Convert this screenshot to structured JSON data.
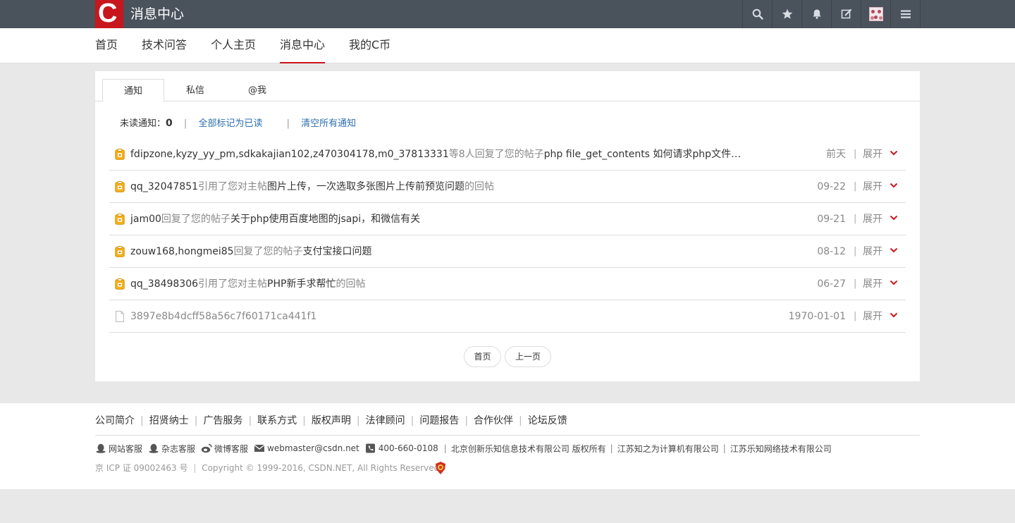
{
  "header": {
    "logo_letter": "C",
    "app_title": "消息中心",
    "icons": [
      "search-icon",
      "star-icon",
      "bell-icon",
      "edit-icon",
      "avatar",
      "menu-icon"
    ]
  },
  "nav": {
    "items": [
      "首页",
      "技术问答",
      "个人主页",
      "消息中心",
      "我的C币"
    ],
    "active": "消息中心"
  },
  "tabs": {
    "items": [
      "通知",
      "私信",
      "@我"
    ],
    "active": "通知"
  },
  "summary": {
    "unread_label": "未读通知：",
    "unread_count": "0",
    "mark_all_read": "全部标记为已读",
    "clear_all": "清空所有通知"
  },
  "notifications": [
    {
      "icon": "notice-icon",
      "parts": [
        {
          "t": "fdipzone,kyzy_yy_pm,sdkakajian102,z470304178,m0_37813331",
          "s": "dark"
        },
        {
          "t": "等8人回复了您的帖子",
          "s": "gray"
        },
        {
          "t": "php file_get_contents 如何请求php文件下的某...",
          "s": "dark"
        }
      ],
      "date": "前天",
      "expand": "展开"
    },
    {
      "icon": "notice-icon",
      "parts": [
        {
          "t": "qq_32047851",
          "s": "dark"
        },
        {
          "t": "引用了您对主帖",
          "s": "gray"
        },
        {
          "t": "图片上传，一次选取多张图片上传前预览问题",
          "s": "dark"
        },
        {
          "t": "的回帖",
          "s": "gray"
        }
      ],
      "date": "09-22",
      "expand": "展开"
    },
    {
      "icon": "notice-icon",
      "parts": [
        {
          "t": "jam00",
          "s": "dark"
        },
        {
          "t": "回复了您的帖子",
          "s": "gray"
        },
        {
          "t": "关于php使用百度地图的jsapi，和微信有关",
          "s": "dark"
        }
      ],
      "date": "09-21",
      "expand": "展开"
    },
    {
      "icon": "notice-icon",
      "parts": [
        {
          "t": "zouw168,hongmei85",
          "s": "dark"
        },
        {
          "t": "回复了您的帖子",
          "s": "gray"
        },
        {
          "t": "支付宝接口问题",
          "s": "dark"
        }
      ],
      "date": "08-12",
      "expand": "展开"
    },
    {
      "icon": "notice-icon",
      "parts": [
        {
          "t": "qq_38498306",
          "s": "dark"
        },
        {
          "t": "引用了您对主帖",
          "s": "gray"
        },
        {
          "t": "PHP新手求帮忙",
          "s": "dark"
        },
        {
          "t": "的回帖",
          "s": "gray"
        }
      ],
      "date": "06-27",
      "expand": "展开"
    },
    {
      "icon": "document-icon",
      "read": true,
      "parts": [
        {
          "t": "3897e8b4dcff58a56c7f60171ca441f1",
          "s": "dark"
        }
      ],
      "date": "1970-01-01",
      "expand": "展开"
    }
  ],
  "pager": {
    "first": "首页",
    "prev": "上一页"
  },
  "footer": {
    "links": [
      "公司简介",
      "招贤纳士",
      "广告服务",
      "联系方式",
      "版权声明",
      "法律顾问",
      "问题报告",
      "合作伙伴",
      "论坛反馈"
    ],
    "contacts": [
      {
        "icon": "qq-icon",
        "label": "网站客服"
      },
      {
        "icon": "qq-icon",
        "label": "杂志客服"
      },
      {
        "icon": "weibo-icon",
        "label": "微博客服"
      },
      {
        "icon": "mail-icon",
        "label": "webmaster@csdn.net"
      },
      {
        "icon": "phone-icon",
        "label": "400-660-0108"
      }
    ],
    "companies": [
      "北京创新乐知信息技术有限公司 版权所有",
      "江苏知之为计算机有限公司",
      "江苏乐知网络技术有限公司"
    ],
    "icp": "京 ICP 证 09002463 号",
    "copyright": "Copyright © 1999-2016, CSDN.NET, All Rights Reserved"
  },
  "colors": {
    "topbar": "#4a525c",
    "brand_red": "#c8161d",
    "link_blue": "#2b6fb0",
    "notice_icon_orange": "#f0a30a"
  }
}
